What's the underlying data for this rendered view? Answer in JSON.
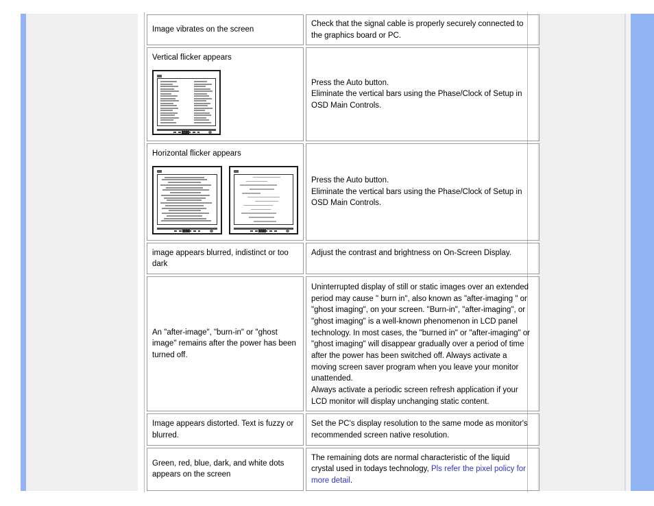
{
  "page": {
    "kind": "monitor-troubleshooting-table",
    "accent_color": "#92b4f4",
    "panel_color": "#efefef",
    "link_color": "#3333cc",
    "border_color": "#9a9a9a"
  },
  "table": {
    "rows": [
      {
        "symptom": "Image vibrates on the screen",
        "solution": "Check that the signal cable is properly securely connected to the graphics board or PC.",
        "figures": []
      },
      {
        "symptom": "Vertical flicker appears",
        "solution": "Press the Auto button.\nEliminate the vertical bars using the Phase/Clock of Setup in\nOSD Main Controls.",
        "figures": [
          "monitor-vertical-flicker"
        ]
      },
      {
        "symptom": "Horizontal flicker appears",
        "solution": "Press the Auto button.\nEliminate the vertical bars using the Phase/Clock of Setup in\nOSD Main Controls.",
        "figures": [
          "monitor-horizontal-flicker-bad",
          "monitor-horizontal-flicker-good"
        ]
      },
      {
        "symptom": "image appears blurred, indistinct or too dark",
        "solution": "Adjust the contrast and brightness on On-Screen Display.",
        "figures": []
      },
      {
        "symptom": "An \"after-image\", \"burn-in\" or \"ghost image\" remains after the power has been turned off.",
        "solution": "Uninterrupted display of still or static images over an extended period may cause \" burn in\", also known as \"after-imaging \" or \"ghost imaging\", on your screen. \"Burn-in\", \"after-imaging\", or \"ghost imaging\" is a well-known phenomenon in LCD panel technology. In most cases, the \"burned in\" or \"after-imaging\" or \"ghost imaging\" will disappear gradually over a period of time after the power has been switched off. Always activate a moving screen saver program when you leave your monitor unattended.\nAlways activate a periodic screen refresh application if your LCD monitor will display unchanging static content.",
        "figures": []
      },
      {
        "symptom": "Image appears distorted. Text   is fuzzy or blurred.",
        "solution": "Set the PC's display resolution to the same mode as monitor's recommended screen native resolution.",
        "figures": []
      },
      {
        "symptom": "Green, red, blue, dark, and white dots appears on the screen",
        "solution_prefix": "The remaining dots are normal characteristic of the liquid crystal used in todays technology, ",
        "solution_link": "Pls refer the pixel policy for more detail",
        "solution_suffix": ".",
        "figures": []
      }
    ]
  }
}
